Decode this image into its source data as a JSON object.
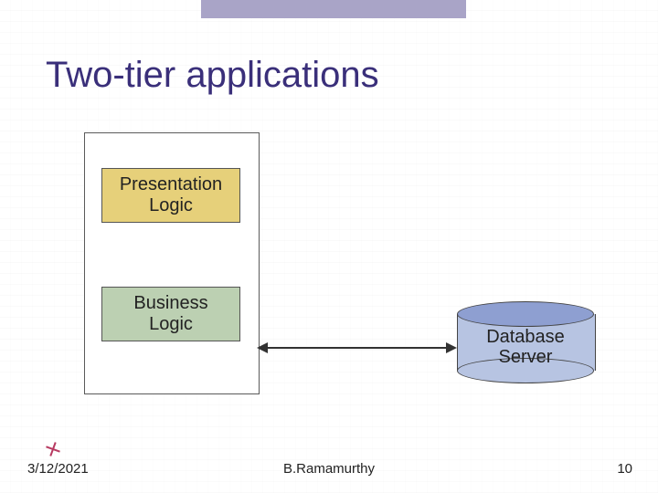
{
  "title": "Two-tier applications",
  "client": {
    "presentation_label": "Presentation\nLogic",
    "business_label": "Business\nLogic"
  },
  "database_label": "Database\nServer",
  "footer": {
    "date": "3/12/2021",
    "author": "B.Ramamurthy",
    "page": "10"
  }
}
